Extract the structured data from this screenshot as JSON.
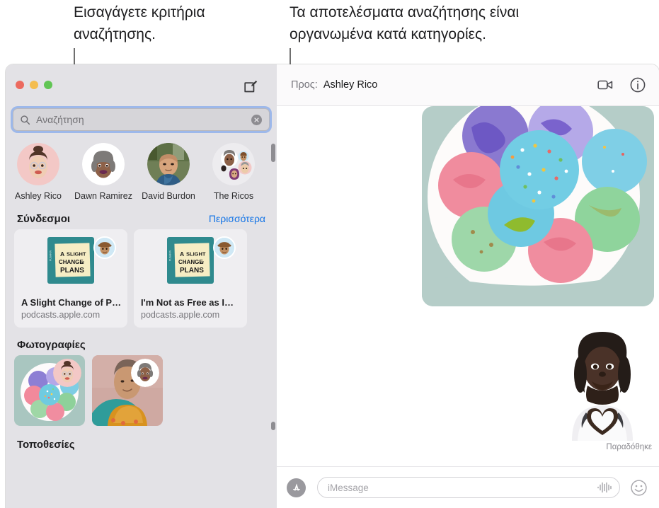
{
  "annotations": {
    "left": "Εισαγάγετε κριτήρια\nαναζήτησης.",
    "right": "Τα αποτελέσματα αναζήτησης είναι\nοργανωμένα κατά κατηγορίες."
  },
  "window": {
    "traffic_lights": [
      "close",
      "minimize",
      "zoom"
    ],
    "compose_icon": "compose-icon"
  },
  "search": {
    "placeholder": "Αναζήτηση",
    "value": "",
    "icon": "search-icon",
    "clear_icon": "clear-icon"
  },
  "contacts": [
    {
      "name": "Ashley Rico",
      "avatar": "memoji-ashley"
    },
    {
      "name": "Dawn Ramirez",
      "avatar": "memoji-dawn"
    },
    {
      "name": "David Burdon",
      "avatar": "photo-david"
    },
    {
      "name": "The Ricos",
      "avatar": "group-ricos"
    }
  ],
  "links_section": {
    "title": "Σύνδεσμοι",
    "more_label": "Περισσότερα",
    "cards": [
      {
        "title": "A Slight Change of P…",
        "domain": "podcasts.apple.com",
        "artwork_text_1": "A",
        "artwork_text_2": "SLIGHT",
        "artwork_text_3": "CHANGE",
        "artwork_text_4": "of",
        "artwork_text_5": "PLANS",
        "badge": "memoji-david"
      },
      {
        "title": "I'm Not as Free as I…",
        "domain": "podcasts.apple.com",
        "artwork_text_1": "A",
        "artwork_text_2": "SLIGHT",
        "artwork_text_3": "CHANGE",
        "artwork_text_4": "of",
        "artwork_text_5": "PLANS",
        "badge": "memoji-david"
      }
    ]
  },
  "photos_section": {
    "title": "Φωτογραφίες",
    "tiles": [
      {
        "name": "photo-macarons",
        "badge": "memoji-ashley"
      },
      {
        "name": "photo-woman-scarf",
        "badge": "memoji-dawn"
      }
    ]
  },
  "locations_section": {
    "title": "Τοποθεσίες"
  },
  "conversation": {
    "to_label": "Προς:",
    "to_name": "Ashley Rico",
    "facetime_icon": "video-camera-icon",
    "info_icon": "info-icon",
    "messages": [
      {
        "type": "photo",
        "name": "message-photo-macarons"
      },
      {
        "type": "sticker",
        "name": "message-memoji-heart-hands"
      }
    ],
    "delivery_status": "Παραδόθηκε"
  },
  "composer": {
    "appstore_icon": "appstore-icon",
    "placeholder": "iMessage",
    "value": "",
    "audio_icon": "audio-waveform-icon",
    "emoji_icon": "emoji-smiley-icon"
  },
  "colors": {
    "accent_link": "#1273e6",
    "focus_ring": "#6495ed",
    "sidebar_bg": "#e3e2e6",
    "traffic_red": "#ec6a5f",
    "traffic_yellow": "#f4bd4f",
    "traffic_green": "#61c554"
  }
}
